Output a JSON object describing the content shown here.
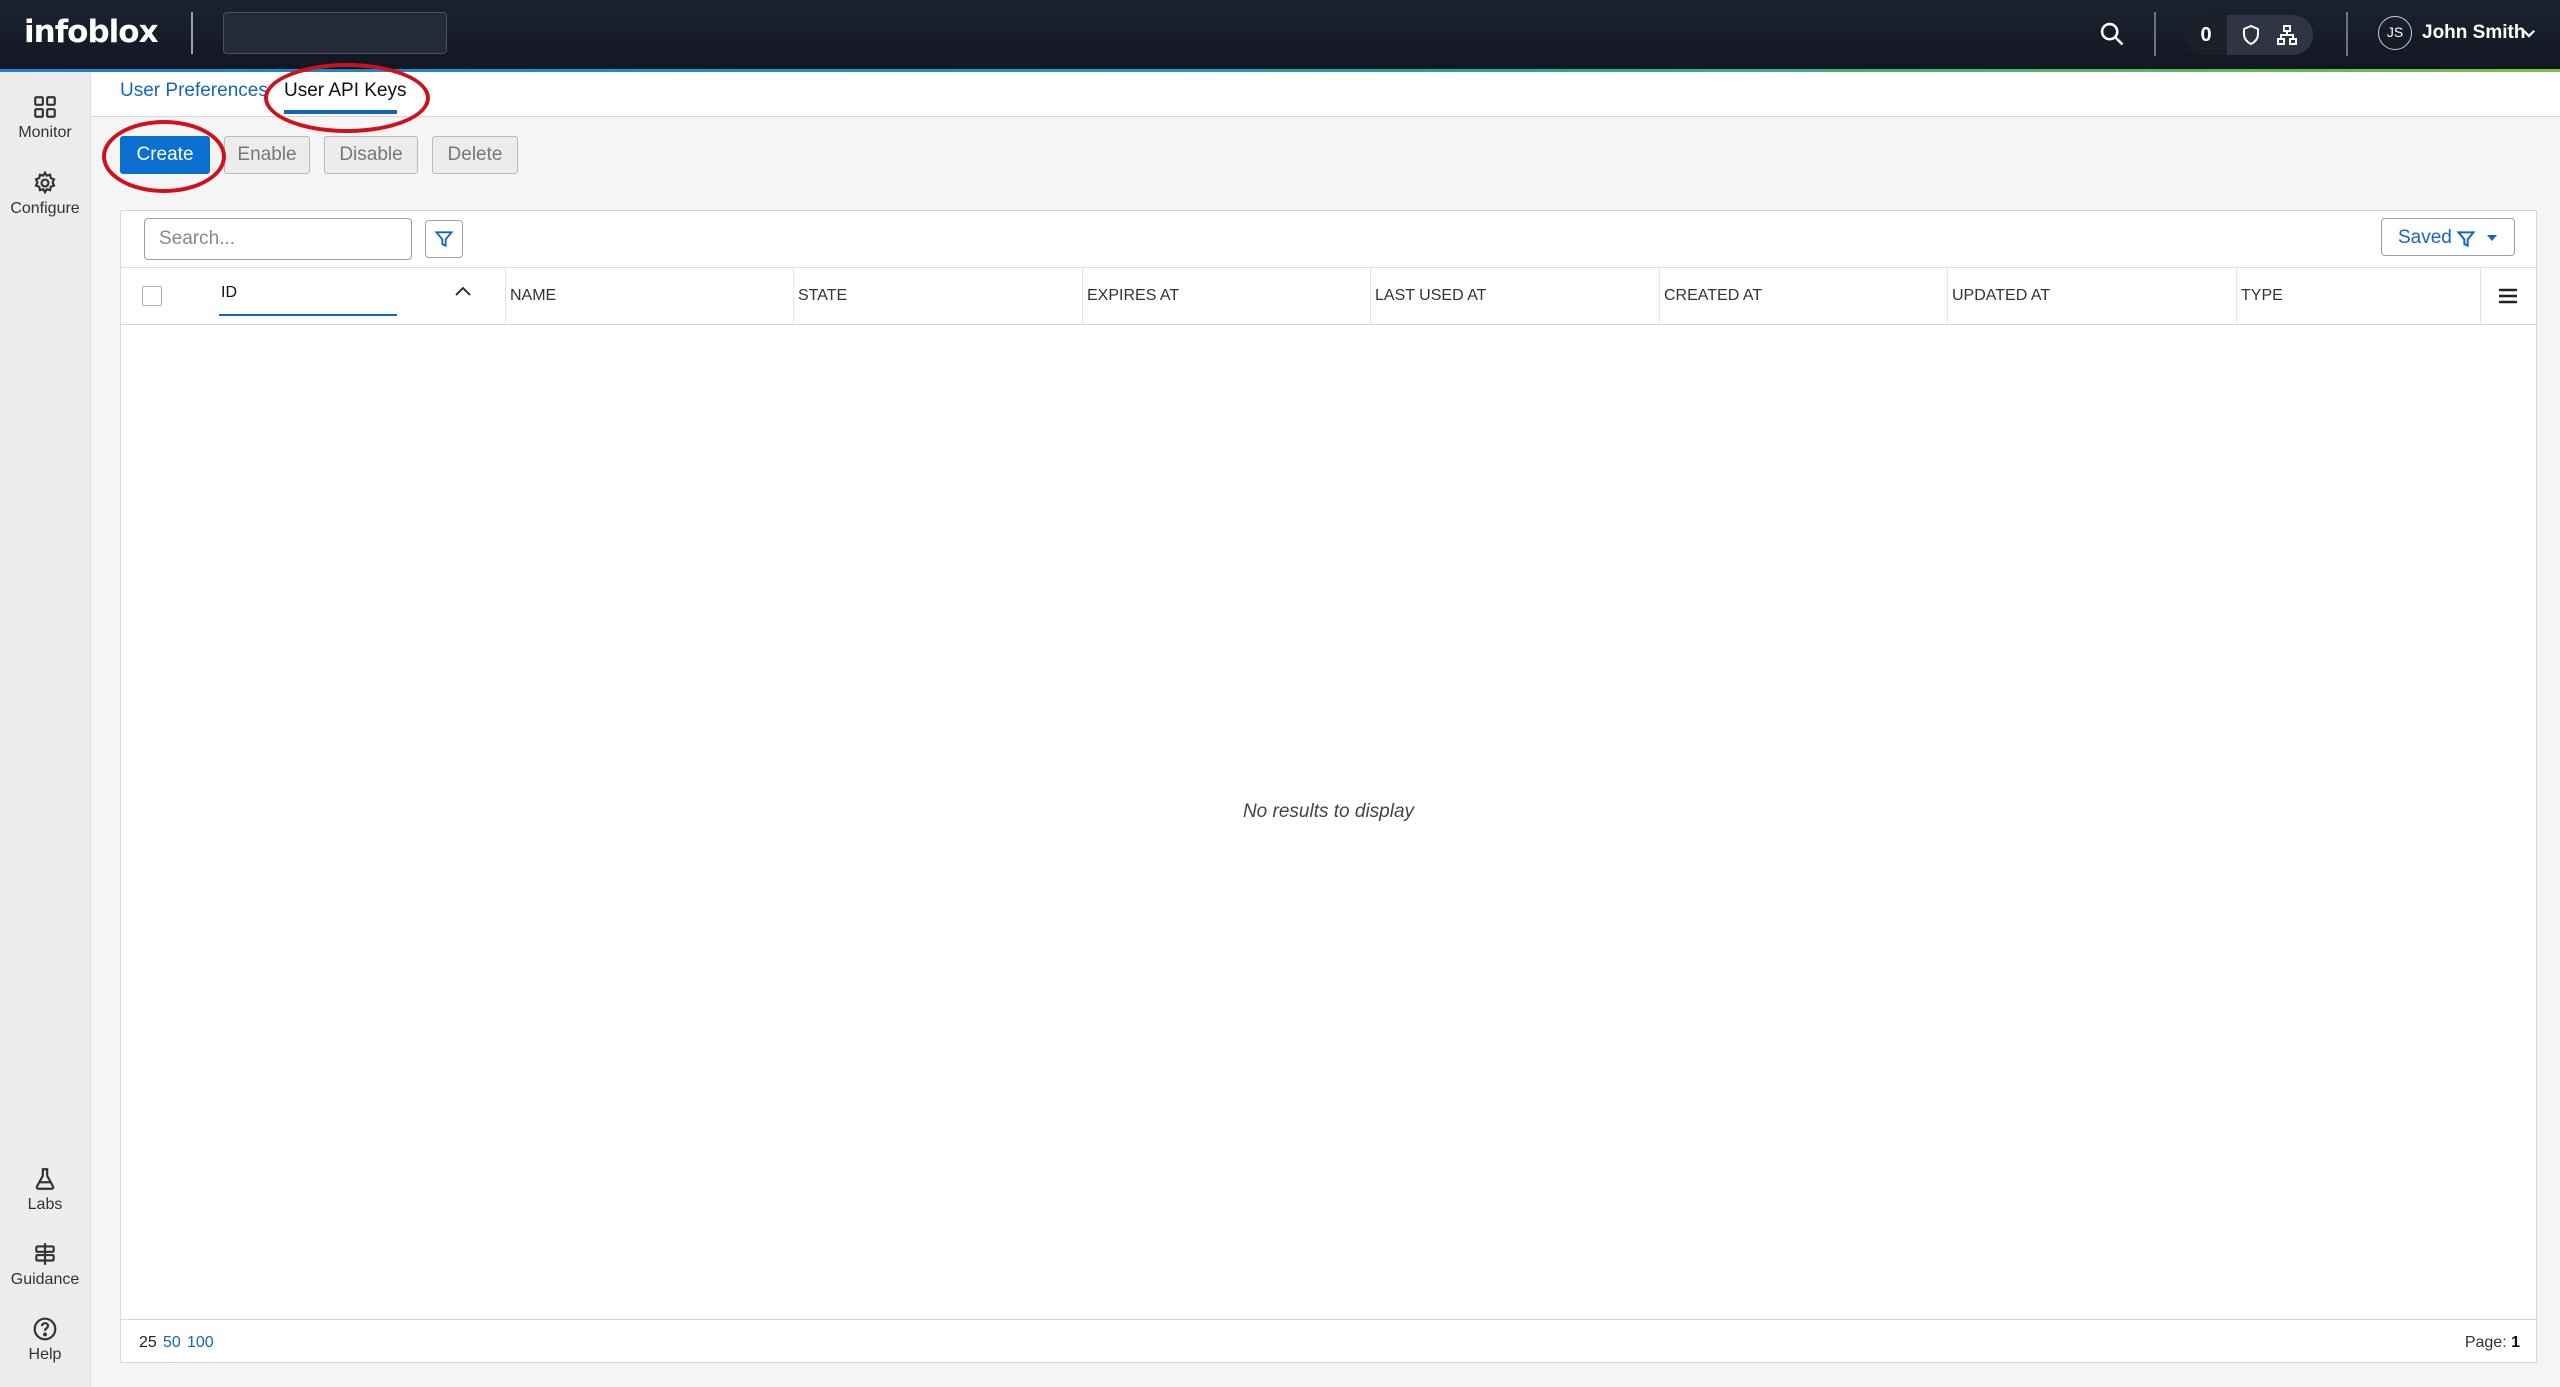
{
  "brand": {
    "logo_text": "infoblox"
  },
  "topbar": {
    "global_search_value": "",
    "notifications_count": "0",
    "user": {
      "initials": "JS",
      "name": "John Smith"
    }
  },
  "nav": {
    "top_items": [
      {
        "label": "Monitor",
        "icon": "grid-icon"
      },
      {
        "label": "Configure",
        "icon": "gear-icon"
      }
    ],
    "bottom_items": [
      {
        "label": "Labs",
        "icon": "flask-icon"
      },
      {
        "label": "Guidance",
        "icon": "signpost-icon"
      },
      {
        "label": "Help",
        "icon": "help-icon"
      }
    ]
  },
  "tabs": [
    {
      "label": "User Preferences",
      "active": false
    },
    {
      "label": "User API Keys",
      "active": true
    }
  ],
  "toolbar": {
    "create": "Create",
    "enable": "Enable",
    "disable": "Disable",
    "delete": "Delete"
  },
  "grid": {
    "search_placeholder": "Search...",
    "search_value": "",
    "saved_label": "Saved",
    "columns": [
      "ID",
      "NAME",
      "STATE",
      "EXPIRES AT",
      "LAST USED AT",
      "CREATED AT",
      "UPDATED AT",
      "TYPE"
    ],
    "sorted_column": "ID",
    "sort_direction": "ascending",
    "rows": [],
    "empty_message": "No results to display",
    "page_sizes": [
      "25",
      "50",
      "100"
    ],
    "selected_page_size": "25",
    "page_label": "Page:",
    "page_number": "1"
  },
  "colors": {
    "primary": "#0b6fd1",
    "link": "#1565c0",
    "topbar": "#121722",
    "annotation": "#d0101b"
  },
  "annotations": [
    {
      "target": "tab-user-api-keys",
      "shape": "ellipse"
    },
    {
      "target": "create-button",
      "shape": "ellipse"
    }
  ]
}
